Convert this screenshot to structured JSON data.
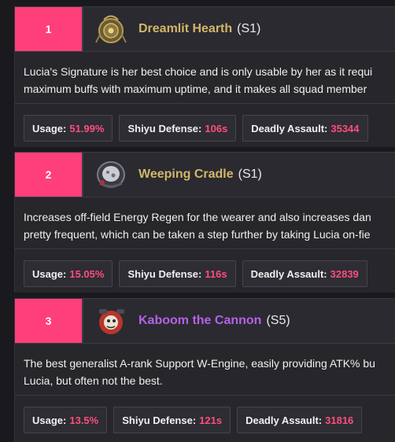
{
  "entries": [
    {
      "rank": "1",
      "name": "Dreamlit Hearth",
      "name_color": "#d2b668",
      "superimpose": "(S1)",
      "icon": "hearth-engine-icon",
      "description_lines": [
        "Lucia's Signature is her best choice and is only usable by her as it requi",
        "maximum buffs with maximum uptime, and it makes all squad member"
      ],
      "usage_label": "Usage:",
      "usage_value": "51.99%",
      "shiyu_label": "Shiyu Defense:",
      "shiyu_value": "106s",
      "deadly_label": "Deadly Assault:",
      "deadly_value": "35344"
    },
    {
      "rank": "2",
      "name": "Weeping Cradle",
      "name_color": "#d2b668",
      "superimpose": "(S1)",
      "icon": "cradle-engine-icon",
      "description_lines": [
        "Increases off-field Energy Regen for the wearer and also increases dan",
        "pretty frequent, which can be taken a step further by taking Lucia on-fie"
      ],
      "usage_label": "Usage:",
      "usage_value": "15.05%",
      "shiyu_label": "Shiyu Defense:",
      "shiyu_value": "116s",
      "deadly_label": "Deadly Assault:",
      "deadly_value": "32839"
    },
    {
      "rank": "3",
      "name": "Kaboom the Cannon",
      "name_color": "#b462e6",
      "superimpose": "(S5)",
      "icon": "cannon-engine-icon",
      "description_lines": [
        "The best generalist A-rank Support W-Engine, easily providing ATK% bu",
        "Lucia, but often not the best."
      ],
      "usage_label": "Usage:",
      "usage_value": "13.5%",
      "shiyu_label": "Shiyu Defense:",
      "shiyu_value": "121s",
      "deadly_label": "Deadly Assault:",
      "deadly_value": "31816"
    }
  ]
}
